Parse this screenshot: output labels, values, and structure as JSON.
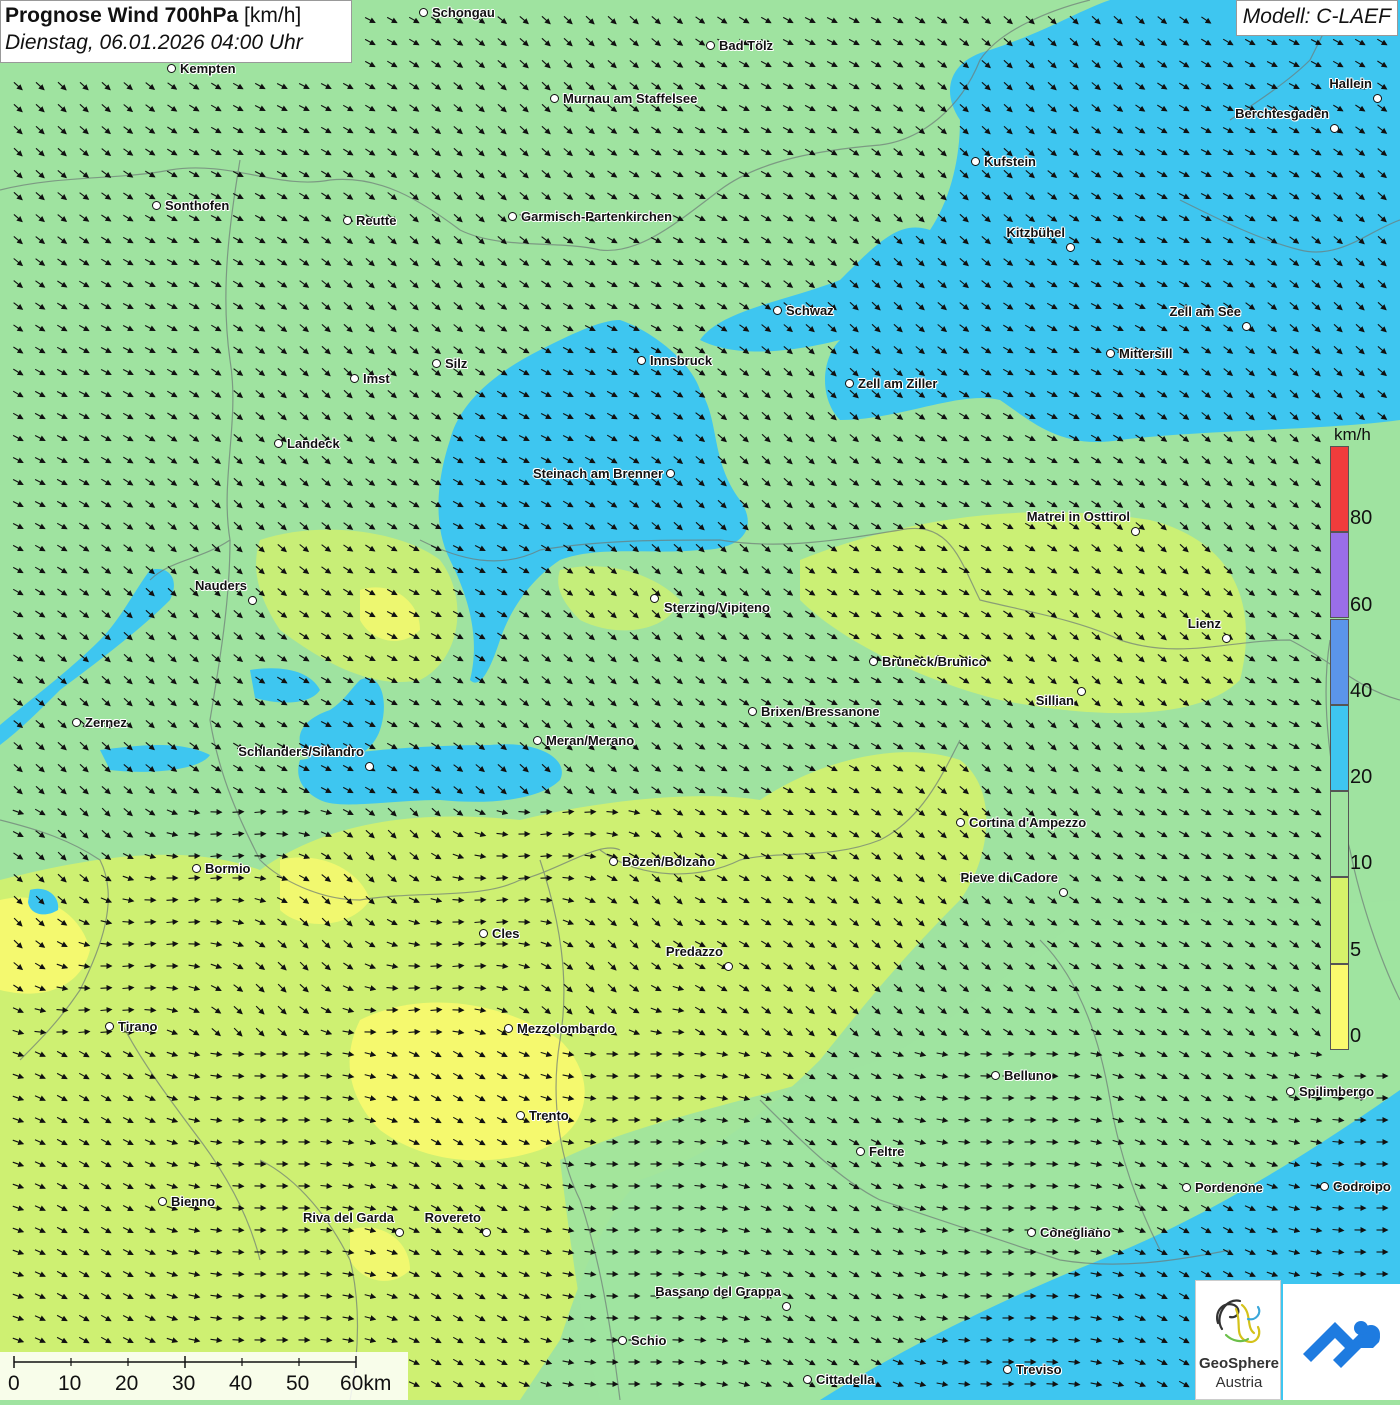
{
  "title": {
    "main": "Prognose Wind 700hPa",
    "unit": "[km/h]",
    "datetime": "Dienstag, 06.01.2026 04:00 Uhr"
  },
  "model": "Modell: C-LAEF",
  "cities": [
    {
      "name": "Schongau"
    },
    {
      "name": "Bad Tölz"
    },
    {
      "name": "Kempten"
    },
    {
      "name": "Murnau am Staffelsee"
    },
    {
      "name": "Hallein"
    },
    {
      "name": "Berchtesgaden"
    },
    {
      "name": "Kufstein"
    },
    {
      "name": "Sonthofen"
    },
    {
      "name": "Reutte"
    },
    {
      "name": "Garmisch-Partenkirchen"
    },
    {
      "name": "Kitzbühel"
    },
    {
      "name": "Schwaz"
    },
    {
      "name": "Zell am See"
    },
    {
      "name": "Innsbruck"
    },
    {
      "name": "Mittersill"
    },
    {
      "name": "Imst"
    },
    {
      "name": "Silz"
    },
    {
      "name": "Zell am Ziller"
    },
    {
      "name": "Landeck"
    },
    {
      "name": "Steinach am Brenner"
    },
    {
      "name": "Matrei in Osttirol"
    },
    {
      "name": "Nauders"
    },
    {
      "name": "Sterzing/Vipiteno"
    },
    {
      "name": "Lienz"
    },
    {
      "name": "Bruneck/Brunico"
    },
    {
      "name": "Sillian"
    },
    {
      "name": "Zernez"
    },
    {
      "name": "Brixen/Bressanone"
    },
    {
      "name": "Meran/Merano"
    },
    {
      "name": "Schlanders/Silandro"
    },
    {
      "name": "Cortina d'Ampezzo"
    },
    {
      "name": "Bozen/Bolzano"
    },
    {
      "name": "Bormio"
    },
    {
      "name": "Pieve di Cadore"
    },
    {
      "name": "Cles"
    },
    {
      "name": "Predazzo"
    },
    {
      "name": "Tirano"
    },
    {
      "name": "Mezzolombardo"
    },
    {
      "name": "Belluno"
    },
    {
      "name": "Spilimbergo"
    },
    {
      "name": "Trento"
    },
    {
      "name": "Feltre"
    },
    {
      "name": "Bienno"
    },
    {
      "name": "Pordenone"
    },
    {
      "name": "Codroipo"
    },
    {
      "name": "Riva del Garda"
    },
    {
      "name": "Rovereto"
    },
    {
      "name": "Conegliano"
    },
    {
      "name": "Bassano del Grappa"
    },
    {
      "name": "Schio"
    },
    {
      "name": "Treviso"
    },
    {
      "name": "Cittadella"
    }
  ],
  "legend": {
    "unit": "km/h",
    "bins": [
      {
        "from": 0,
        "to": 5,
        "color": "#fafa6e"
      },
      {
        "from": 5,
        "to": 10,
        "color": "#d6f26a"
      },
      {
        "from": 10,
        "to": 20,
        "color": "#9fe3a0"
      },
      {
        "from": 20,
        "to": 40,
        "color": "#3ec6f0"
      },
      {
        "from": 40,
        "to": 60,
        "color": "#5b95ea"
      },
      {
        "from": 60,
        "to": 80,
        "color": "#9a6ee8"
      },
      {
        "from": 80,
        "to": 100,
        "color": "#f03c3c"
      }
    ],
    "labels": [
      "0",
      "5",
      "10",
      "20",
      "40",
      "60",
      "80"
    ]
  },
  "scalebar": {
    "ticks": [
      "0",
      "10",
      "20",
      "30",
      "40",
      "50",
      "60km"
    ]
  },
  "logos": {
    "geosphere_line1": "GeoSphere",
    "geosphere_line2": "Austria"
  },
  "wind_direction": "arrows pointing south-east"
}
